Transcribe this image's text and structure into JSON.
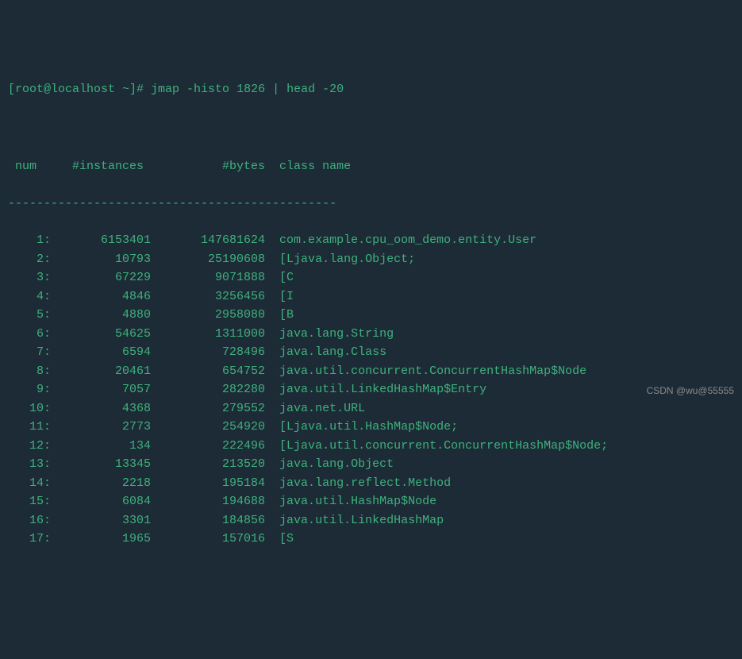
{
  "prompt": {
    "user_host": "[root@localhost ~]#",
    "command": "jmap -histo 1826 | head -20"
  },
  "header": {
    "num": "num",
    "instances": "#instances",
    "bytes": "#bytes",
    "classname": "class name"
  },
  "divider": "----------------------------------------------",
  "rows": [
    {
      "num": "1:",
      "instances": "6153401",
      "bytes": "147681624",
      "classname": "com.example.cpu_oom_demo.entity.User"
    },
    {
      "num": "2:",
      "instances": "10793",
      "bytes": "25190608",
      "classname": "[Ljava.lang.Object;"
    },
    {
      "num": "3:",
      "instances": "67229",
      "bytes": "9071888",
      "classname": "[C"
    },
    {
      "num": "4:",
      "instances": "4846",
      "bytes": "3256456",
      "classname": "[I"
    },
    {
      "num": "5:",
      "instances": "4880",
      "bytes": "2958080",
      "classname": "[B"
    },
    {
      "num": "6:",
      "instances": "54625",
      "bytes": "1311000",
      "classname": "java.lang.String"
    },
    {
      "num": "7:",
      "instances": "6594",
      "bytes": "728496",
      "classname": "java.lang.Class"
    },
    {
      "num": "8:",
      "instances": "20461",
      "bytes": "654752",
      "classname": "java.util.concurrent.ConcurrentHashMap$Node"
    },
    {
      "num": "9:",
      "instances": "7057",
      "bytes": "282280",
      "classname": "java.util.LinkedHashMap$Entry"
    },
    {
      "num": "10:",
      "instances": "4368",
      "bytes": "279552",
      "classname": "java.net.URL"
    },
    {
      "num": "11:",
      "instances": "2773",
      "bytes": "254920",
      "classname": "[Ljava.util.HashMap$Node;"
    },
    {
      "num": "12:",
      "instances": "134",
      "bytes": "222496",
      "classname": "[Ljava.util.concurrent.ConcurrentHashMap$Node;"
    },
    {
      "num": "13:",
      "instances": "13345",
      "bytes": "213520",
      "classname": "java.lang.Object"
    },
    {
      "num": "14:",
      "instances": "2218",
      "bytes": "195184",
      "classname": "java.lang.reflect.Method"
    },
    {
      "num": "15:",
      "instances": "6084",
      "bytes": "194688",
      "classname": "java.util.HashMap$Node"
    },
    {
      "num": "16:",
      "instances": "3301",
      "bytes": "184856",
      "classname": "java.util.LinkedHashMap"
    },
    {
      "num": "17:",
      "instances": "1965",
      "bytes": "157016",
      "classname": "[S"
    }
  ],
  "watermark": "CSDN @wu@55555"
}
